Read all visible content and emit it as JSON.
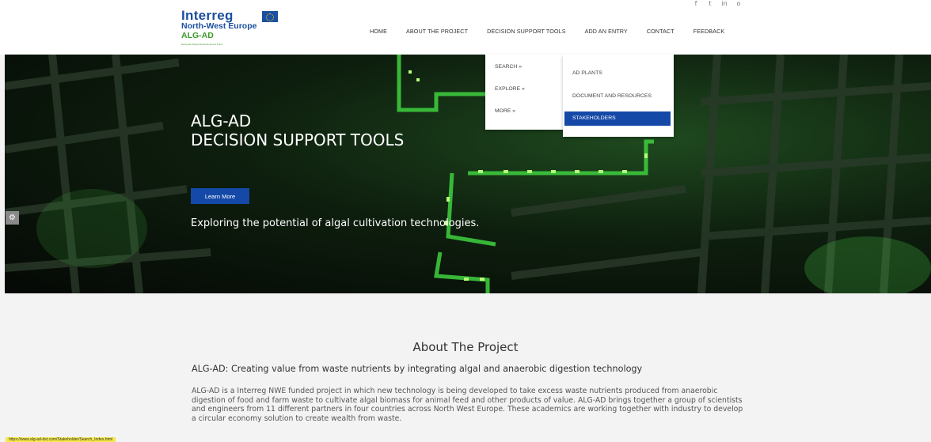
{
  "logo": {
    "line1": "Interreg",
    "line2": "North-West Europe",
    "line3": "ALG-AD",
    "line4": "European Regional Development Fund"
  },
  "social": [
    "f",
    "t",
    "in",
    "o"
  ],
  "nav": {
    "home": "HOME",
    "about": "ABOUT THE PROJECT",
    "tools": "DECISION SUPPORT TOOLS",
    "add": "ADD AN ENTRY",
    "contact": "CONTACT",
    "feedback": "FEEDBACK"
  },
  "dropdown1": {
    "search": "SEARCH »",
    "explore": "EXPLORE »",
    "more": "MORE »"
  },
  "dropdown2": {
    "ad_plants": "AD PLANTS",
    "documents": "DOCUMENT AND RESOURCES",
    "stakeholders": "STAKEHOLDERS"
  },
  "hero": {
    "title_line1": "ALG-AD",
    "title_line2": "DECISION SUPPORT TOOLS",
    "button": "Learn More",
    "subtitle": "Exploring the potential of algal cultivation technologies."
  },
  "about": {
    "title": "About The Project",
    "subtitle": "ALG-AD: Creating value from waste nutrients by integrating algal and anaerobic digestion technology",
    "body": "ALG-AD is a Interreg NWE funded project in which new technology is being developed to take excess waste nutrients produced from anaerobic digestion of food and farm waste to cultivate algal biomass for animal feed and other products of value. ALG-AD brings together a group of scientists and engineers from 11 different partners in four countries across North West Europe. These academics are working together with industry to develop a circular economy solution to create wealth from waste."
  },
  "status_url": "https://www.alg-ad-dst.com/Stakeholder/Search_Index.html"
}
